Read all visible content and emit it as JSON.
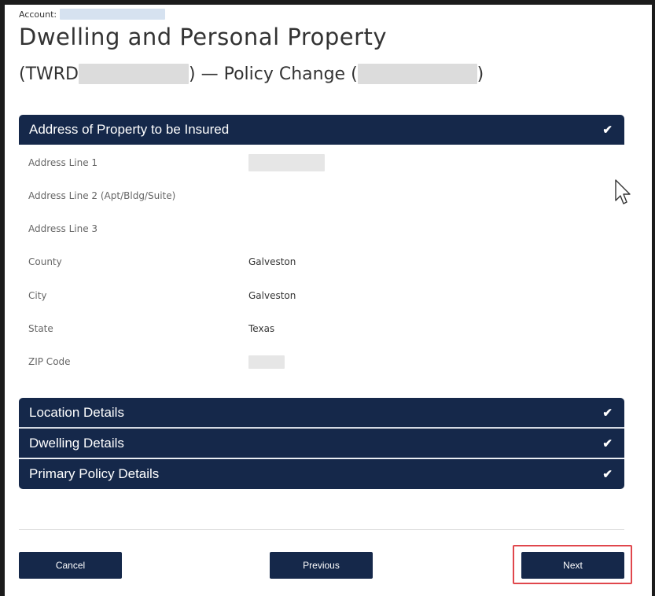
{
  "header": {
    "account_label": "Account:",
    "title": "Dwelling and Personal Property",
    "subtitle_prefix": "(TWRD",
    "subtitle_middle": ") — Policy Change (",
    "subtitle_suffix": ")"
  },
  "sections": {
    "address": {
      "title": "Address of Property to be Insured",
      "status_icon": "check-icon",
      "fields": [
        {
          "label": "Address Line 1",
          "value": ""
        },
        {
          "label": "Address Line 2 (Apt/Bldg/Suite)",
          "value": ""
        },
        {
          "label": "Address Line 3",
          "value": ""
        },
        {
          "label": "County",
          "value": "Galveston"
        },
        {
          "label": "City",
          "value": "Galveston"
        },
        {
          "label": "State",
          "value": "Texas"
        },
        {
          "label": "ZIP Code",
          "value": ""
        }
      ]
    },
    "location": {
      "title": "Location Details",
      "status_icon": "check-icon"
    },
    "dwelling": {
      "title": "Dwelling Details",
      "status_icon": "check-icon"
    },
    "primary_policy": {
      "title": "Primary Policy Details",
      "status_icon": "check-icon"
    }
  },
  "buttons": {
    "cancel": "Cancel",
    "previous": "Previous",
    "next": "Next"
  },
  "colors": {
    "header_bg": "#15284a",
    "highlight": "#e0474c"
  }
}
